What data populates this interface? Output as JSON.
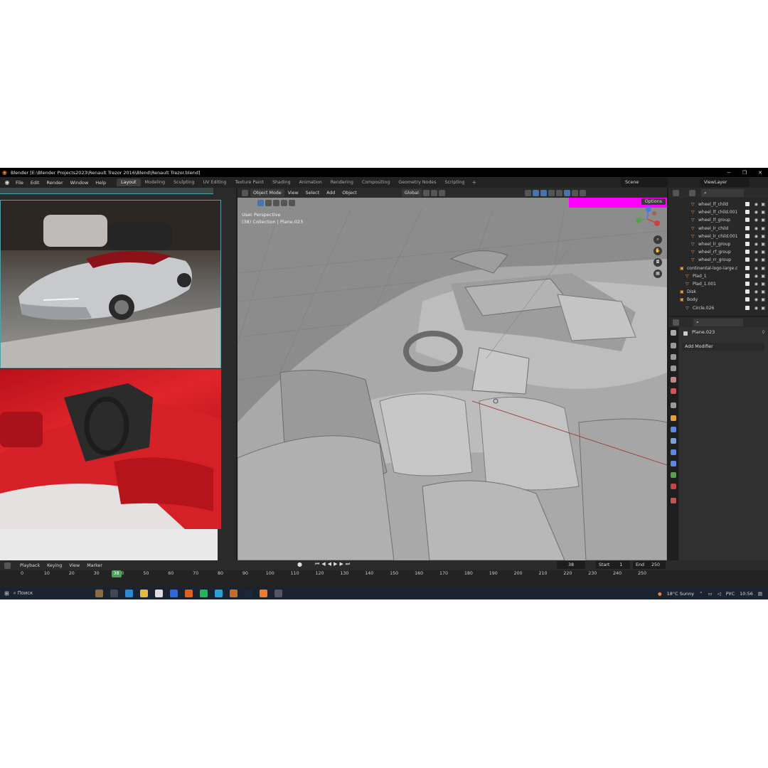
{
  "window": {
    "title": "Blender [E:\\Blender Projects2023\\Renault Trezor 2016\\Blend\\Renault Trezor.blend]",
    "minimize": "−",
    "maximize": "❐",
    "close": "✕"
  },
  "menu": [
    "File",
    "Edit",
    "Render",
    "Window",
    "Help"
  ],
  "workspaces": [
    "Layout",
    "Modeling",
    "Sculpting",
    "UV Editing",
    "Texture Paint",
    "Shading",
    "Animation",
    "Rendering",
    "Compositing",
    "Geometry Nodes",
    "Scripting"
  ],
  "active_workspace": "Layout",
  "scene": "Scene",
  "view_layer": "ViewLayer",
  "viewport": {
    "mode": "Object Mode",
    "menus": [
      "View",
      "Select",
      "Add",
      "Object"
    ],
    "transform": "Global",
    "info_line1": "User Perspective",
    "info_line2": "(38) Collection | Plane.023",
    "options": "Options"
  },
  "outliner": {
    "rows": [
      {
        "name": "wheel_lf_child",
        "indent": 2
      },
      {
        "name": "wheel_lf_child.001",
        "indent": 2
      },
      {
        "name": "wheel_lf_group",
        "indent": 2
      },
      {
        "name": "wheel_lr_child",
        "indent": 2
      },
      {
        "name": "wheel_lr_child.001",
        "indent": 2
      },
      {
        "name": "wheel_lr_group",
        "indent": 2
      },
      {
        "name": "wheel_rf_group",
        "indent": 2
      },
      {
        "name": "wheel_rr_group",
        "indent": 2
      },
      {
        "name": "continental-logo-large.c",
        "indent": 0
      },
      {
        "name": "Plad_1",
        "indent": 1
      },
      {
        "name": "Plad_1.001",
        "indent": 1
      },
      {
        "name": "Disk",
        "indent": 0
      },
      {
        "name": "Body",
        "indent": 0
      },
      {
        "name": "Circle.026",
        "indent": 1
      }
    ]
  },
  "properties": {
    "object_name": "Plane.023",
    "add_modifier": "Add Modifier"
  },
  "timeline": {
    "menus": [
      "Playback",
      "Keying",
      "View",
      "Marker"
    ],
    "current_frame": "38",
    "start_label": "Start",
    "start": "1",
    "end_label": "End",
    "end": "250",
    "ticks": [
      0,
      10,
      20,
      30,
      40,
      50,
      60,
      70,
      80,
      90,
      100,
      110,
      120,
      130,
      140,
      150,
      160,
      170,
      180,
      190,
      200,
      210,
      220,
      230,
      240,
      250
    ],
    "marker_label": "38"
  },
  "taskbar": {
    "search": "Поиск",
    "weather": "18°C  Sunny",
    "lang": "РУС",
    "time": "10:56"
  },
  "colors": {
    "accent": "#4772b3",
    "frame_marker": "#4aa35a",
    "magenta_overlay": "#ff00ff",
    "blender_orange": "#f5792a"
  }
}
